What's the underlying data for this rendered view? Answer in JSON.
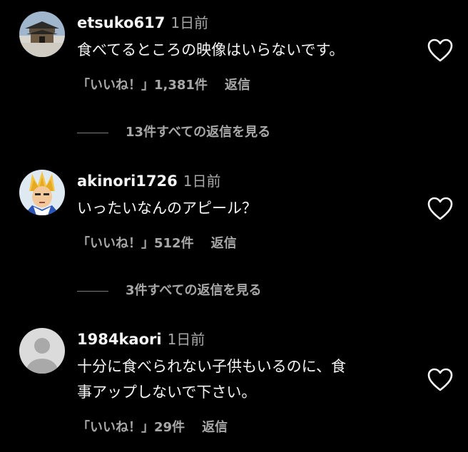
{
  "comments": [
    {
      "username": "etsuko617",
      "time": "1日前",
      "text": "食べてるところの映像はいらないです。",
      "likes": "「いいね！」1,381件",
      "reply_label": "返信",
      "view_replies": "13件すべての返信を見る",
      "avatar_icon": "temple-photo-avatar"
    },
    {
      "username": "akinori1726",
      "time": "1日前",
      "text": "いったいなんのアピール？",
      "likes": "「いいね！」512件",
      "reply_label": "返信",
      "view_replies": "3件すべての返信を見る",
      "avatar_icon": "anime-character-avatar"
    },
    {
      "username": "1984kaori",
      "time": "1日前",
      "text_line1": "十分に食べられない子供もいるのに、食",
      "text_line2": "事アップしないで下さい。",
      "likes": "「いいね！」29件",
      "reply_label": "返信",
      "avatar_icon": "default-user-avatar"
    }
  ],
  "icons": {
    "like": "heart-outline-icon"
  },
  "colors": {
    "background": "#000000",
    "primary_text": "#f5f5f5",
    "secondary_text": "#a8a8a8"
  }
}
